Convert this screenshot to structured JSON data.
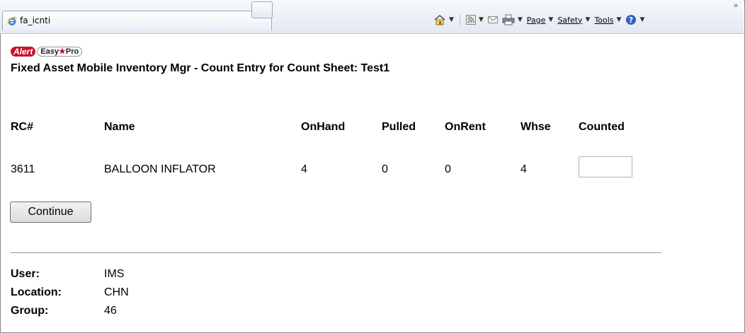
{
  "tab": {
    "title": "fa_icnti"
  },
  "command_bar": {
    "page_label": "Page",
    "safety_label": "Safety",
    "tools_label": "Tools"
  },
  "brand": {
    "alert": "Alert",
    "easy": "Easy",
    "pro": "Pro"
  },
  "page_title": "Fixed Asset Mobile Inventory Mgr - Count Entry for Count Sheet: Test1",
  "table": {
    "headers": {
      "rc": "RC#",
      "name": "Name",
      "onhand": "OnHand",
      "pulled": "Pulled",
      "onrent": "OnRent",
      "whse": "Whse",
      "counted": "Counted"
    },
    "row": {
      "rc": "3611",
      "name": "BALLOON INFLATOR",
      "onhand": "4",
      "pulled": "0",
      "onrent": "0",
      "whse": "4",
      "counted_value": ""
    }
  },
  "continue_label": "Continue",
  "footer": {
    "user_label": "User:",
    "user_value": "IMS",
    "location_label": "Location:",
    "location_value": "CHN",
    "group_label": "Group:",
    "group_value": "46"
  },
  "colors": {
    "brand_red": "#c8102e",
    "toolbar_bg": "#e3e9f2"
  }
}
